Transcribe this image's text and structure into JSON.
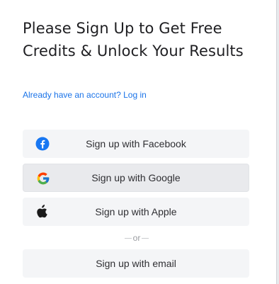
{
  "signup": {
    "title": "Please Sign Up to Get Free Credits & Unlock Your Results",
    "login_prompt": "Already have an account? Log in",
    "buttons": {
      "facebook": {
        "label": "Sign up with Facebook",
        "icon": "facebook-icon"
      },
      "google": {
        "label": "Sign up with Google",
        "icon": "google-icon"
      },
      "apple": {
        "label": "Sign up with Apple",
        "icon": "apple-icon"
      },
      "email": {
        "label": "Sign up with email"
      }
    },
    "divider_text": "or"
  },
  "colors": {
    "link": "#1a73e8",
    "button_bg": "#f4f5f7",
    "facebook_blue": "#1877f2",
    "text": "#1f1f22"
  }
}
